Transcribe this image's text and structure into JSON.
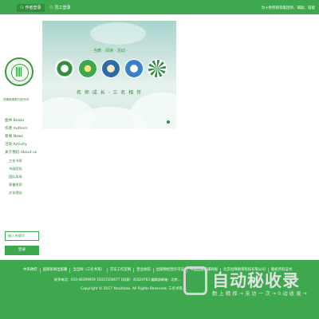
{
  "header": {
    "author_login": "作者登录",
    "staff_login": "员工登录",
    "slogan": "为十余所教育集团师、辅助、陪督"
  },
  "sidebar": {
    "org_name": "恒降新闻期刊发布市",
    "nav": [
      "图书 Books",
      "作者 Authors",
      "新闻 News",
      "活动 Activity",
      "关于我们 About us"
    ],
    "subnav": [
      "三名书系",
      "书画团队",
      "团队风采",
      "荣誉资质",
      "文化理念"
    ],
    "input_placeholder": "输入关键字",
    "login_label": "登录"
  },
  "banner": {
    "slogan_top": "· 当教 · 阅读 · 活动 ·",
    "slogan_bottom": "名 师 成 长 · 三 名 相 伴",
    "colors": {
      "green": "#3ea84e",
      "dark_green": "#2f8f3e",
      "blue": "#2d6aa8",
      "red": "#c43a3a"
    }
  },
  "footer": {
    "links": [
      "中央政府",
      "国家新闻出版署",
      "当当网（三名书系）",
      "京东工作室网",
      "营业执照",
      "出版物经营许可证",
      "中国出版传媒商报",
      "北京恒降教育科技有限公司",
      "版权所有证书"
    ],
    "contact": "联系电话：010-56399959 15021556677  QQ群：41824763  编辑部邮箱：北京...",
    "copyright": "Copyright © 2017 Yaruhizao. All Rights Reserved.  三名书系 ..."
  },
  "watermark": {
    "title": "自动秘收录",
    "tagline": "数 上 精 择 → 未 访 一 次 → 0 动 收 录 →"
  }
}
